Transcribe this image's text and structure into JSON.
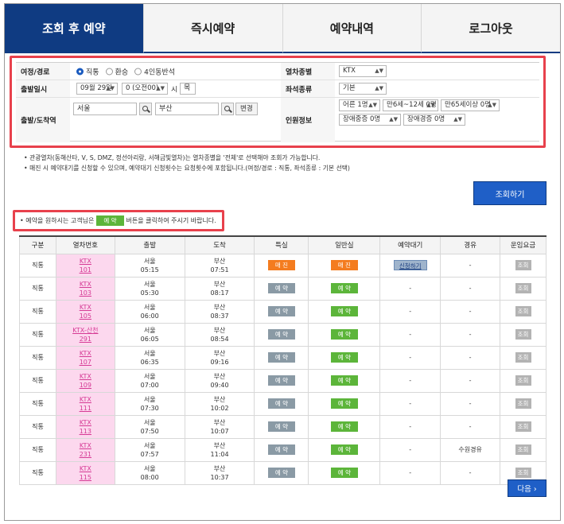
{
  "tabs": [
    {
      "label": "조회 후 예약",
      "active": true
    },
    {
      "label": "즉시예약",
      "active": false
    },
    {
      "label": "예약내역",
      "active": false
    },
    {
      "label": "로그아웃",
      "active": false
    }
  ],
  "form": {
    "route_label": "여정/경로",
    "route_options": [
      "직통",
      "환승",
      "4인동반석"
    ],
    "route_selected": "직통",
    "train_type_label": "열차종별",
    "train_type_value": "KTX",
    "depart_label": "출발일시",
    "date_value": "09월 29일",
    "hour_value": "0 (오전00)",
    "hour_suffix": "시",
    "weekday_value": "목",
    "seat_type_label": "좌석종류",
    "seat_type_value": "기본",
    "station_label": "출발/도착역",
    "origin_value": "서울",
    "dest_value": "부산",
    "swap_label": "변경",
    "passenger_label": "인원정보",
    "pax_adult": "어른 1명",
    "pax_child": "만6세~12세 0명",
    "pax_senior": "만65세이상 0명",
    "pax_disabled_severe": "장애중증 0명",
    "pax_disabled_mild": "장애경증 0명"
  },
  "notes": [
    "관광열차(동해산타, V, S, DMZ, 정선아리랑, 서해금빛열차)는 열차종별을 '전체'로 선택해야 조회가 가능합니다.",
    "매진 시 예약대기를 신청할 수 있으며, 예약대기 신청횟수는 요청횟수에 포함됩니다.(여정/경로 : 직통, 좌석종류 : 기본 선택)"
  ],
  "search_button": "조회하기",
  "hint": {
    "before": "• 예약을 원하시는 고객님은",
    "button": "예 약",
    "after": "버튼을 클릭하여 주시기 바랍니다."
  },
  "table": {
    "headers": [
      "구분",
      "열차번호",
      "출발",
      "도착",
      "특실",
      "일반실",
      "예약대기",
      "경유",
      "운임요금"
    ],
    "rows": [
      {
        "type": "직통",
        "train": "KTX 101",
        "from": "서울",
        "dep": "05:15",
        "to": "부산",
        "arr": "07:51",
        "first": "매 진",
        "general": "매 진",
        "waitlist": "신청하기",
        "via": "-",
        "fare": "조회"
      },
      {
        "type": "직통",
        "train": "KTX 103",
        "from": "서울",
        "dep": "05:30",
        "to": "부산",
        "arr": "08:17",
        "first": "예 약",
        "general": "예 약",
        "waitlist": "-",
        "via": "-",
        "fare": "조회"
      },
      {
        "type": "직통",
        "train": "KTX 105",
        "from": "서울",
        "dep": "06:00",
        "to": "부산",
        "arr": "08:37",
        "first": "예 약",
        "general": "예 약",
        "waitlist": "-",
        "via": "-",
        "fare": "조회"
      },
      {
        "type": "직통",
        "train": "KTX-산천 291",
        "from": "서울",
        "dep": "06:05",
        "to": "부산",
        "arr": "08:54",
        "first": "예 약",
        "general": "예 약",
        "waitlist": "-",
        "via": "-",
        "fare": "조회"
      },
      {
        "type": "직통",
        "train": "KTX 107",
        "from": "서울",
        "dep": "06:35",
        "to": "부산",
        "arr": "09:16",
        "first": "예 약",
        "general": "예 약",
        "waitlist": "-",
        "via": "-",
        "fare": "조회"
      },
      {
        "type": "직통",
        "train": "KTX 109",
        "from": "서울",
        "dep": "07:00",
        "to": "부산",
        "arr": "09:40",
        "first": "예 약",
        "general": "예 약",
        "waitlist": "-",
        "via": "-",
        "fare": "조회"
      },
      {
        "type": "직통",
        "train": "KTX 111",
        "from": "서울",
        "dep": "07:30",
        "to": "부산",
        "arr": "10:02",
        "first": "예 약",
        "general": "예 약",
        "waitlist": "-",
        "via": "-",
        "fare": "조회"
      },
      {
        "type": "직통",
        "train": "KTX 113",
        "from": "서울",
        "dep": "07:50",
        "to": "부산",
        "arr": "10:07",
        "first": "예 약",
        "general": "예 약",
        "waitlist": "-",
        "via": "-",
        "fare": "조회"
      },
      {
        "type": "직통",
        "train": "KTX 231",
        "from": "서울",
        "dep": "07:57",
        "to": "부산",
        "arr": "11:04",
        "first": "예 약",
        "general": "예 약",
        "waitlist": "-",
        "via": "수원경유",
        "fare": "조회"
      },
      {
        "type": "직통",
        "train": "KTX 115",
        "from": "서울",
        "dep": "08:00",
        "to": "부산",
        "arr": "10:37",
        "first": "예 약",
        "general": "예 약",
        "waitlist": "-",
        "via": "-",
        "fare": "조회"
      }
    ]
  },
  "next_button": "다음 ›",
  "colors": {
    "nav_active": "#0f3b82",
    "sold_out": "#f47c1f",
    "reserve_general": "#5cb53a",
    "reserve_first": "#8a9aa5",
    "highlight": "#e8414c",
    "train_cell": "#fcd8ee"
  }
}
